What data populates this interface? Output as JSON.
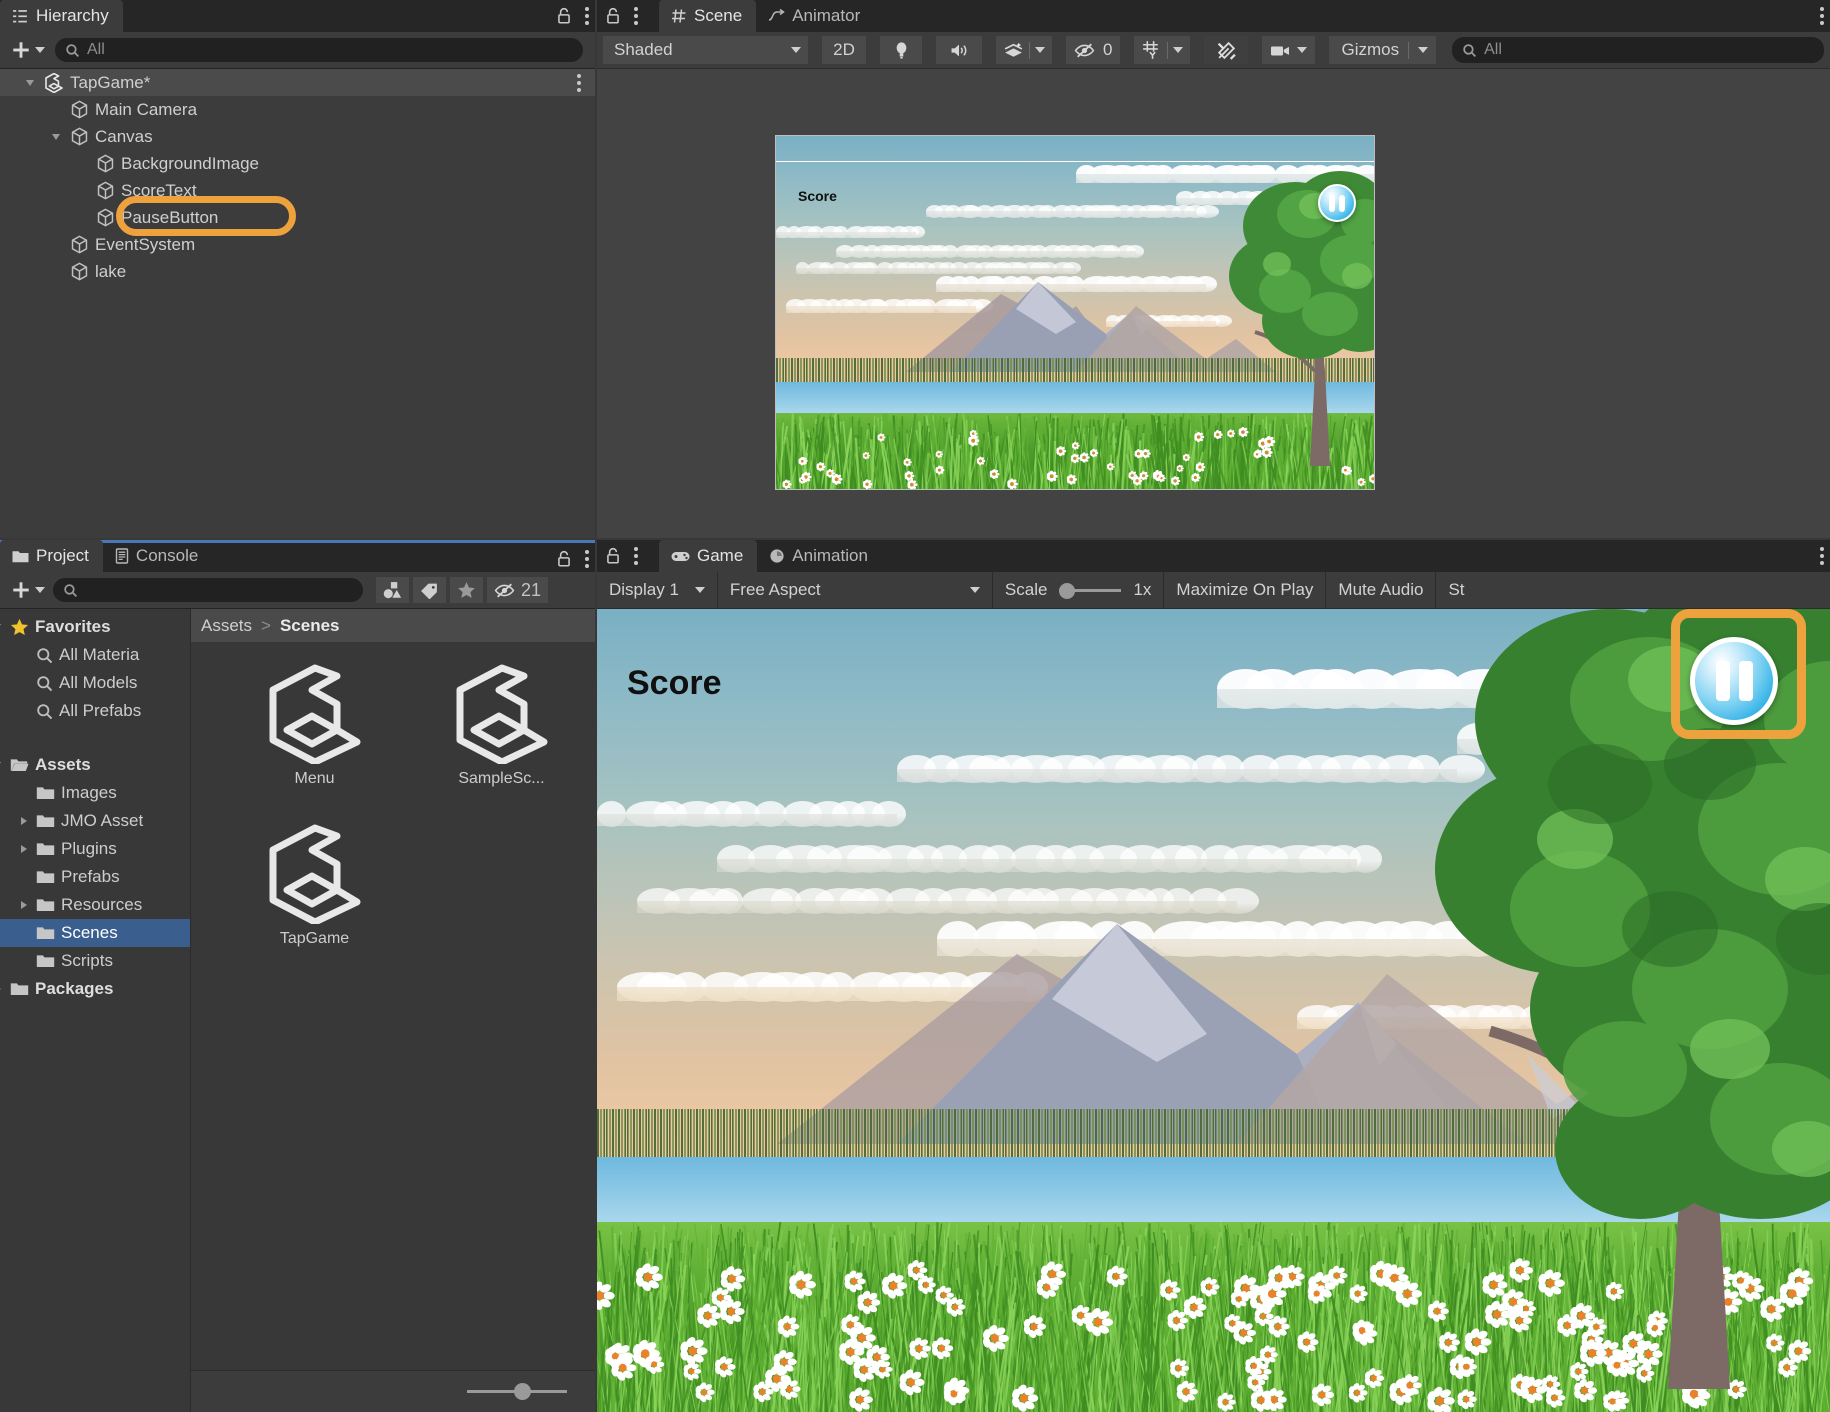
{
  "hierarchy": {
    "tab_label": "Hierarchy",
    "tab_icon": "hierarchy-icon",
    "search_placeholder": "All",
    "search_value": "",
    "items": [
      {
        "label": "TapGame*",
        "depth": 0,
        "icon": "unity-scene-icon",
        "expanded": true,
        "selected": true,
        "kebab": true
      },
      {
        "label": "Main Camera",
        "depth": 1,
        "icon": "gameobject-icon",
        "expanded": null
      },
      {
        "label": "Canvas",
        "depth": 1,
        "icon": "gameobject-icon",
        "expanded": true
      },
      {
        "label": "BackgroundImage",
        "depth": 2,
        "icon": "gameobject-icon",
        "expanded": null
      },
      {
        "label": "ScoreText",
        "depth": 2,
        "icon": "gameobject-icon",
        "expanded": null
      },
      {
        "label": "PauseButton",
        "depth": 2,
        "icon": "gameobject-icon",
        "expanded": null,
        "highlighted": true
      },
      {
        "label": "EventSystem",
        "depth": 1,
        "icon": "gameobject-icon",
        "expanded": null
      },
      {
        "label": "lake",
        "depth": 1,
        "icon": "gameobject-icon",
        "expanded": null
      }
    ]
  },
  "scene": {
    "tabs": [
      {
        "label": "Scene",
        "icon": "scene-grid-icon",
        "active": true
      },
      {
        "label": "Animator",
        "icon": "animator-icon",
        "active": false
      }
    ],
    "toolbar": {
      "shading_mode": "Shaded",
      "mode_2d": "2D",
      "lighting_icon": "lightbulb-icon",
      "audio_icon": "speaker-icon",
      "fx_icon": "effects-icon",
      "hidden_icon": "eye-off-icon",
      "hidden_count": "0",
      "grid_icon": "grid-y-icon",
      "tools_icon": "tools-icon",
      "camera_icon": "camera-icon",
      "gizmos_label": "Gizmos",
      "search_placeholder": "All",
      "search_value": ""
    },
    "viewport": {
      "score_label": "Score",
      "pause_icon": "pause-icon"
    }
  },
  "project": {
    "tabs": [
      {
        "label": "Project",
        "icon": "folder-icon",
        "active": true
      },
      {
        "label": "Console",
        "icon": "console-icon",
        "active": false
      }
    ],
    "toolbar": {
      "search_placeholder": "",
      "search_value": "",
      "filter_type_icon": "shapes-filter-icon",
      "filter_label_icon": "tag-icon",
      "favorite_icon": "star-icon",
      "hidden_icon": "eye-off-icon",
      "hidden_count": "21"
    },
    "tree": [
      {
        "label": "Favorites",
        "depth": 0,
        "icon": "star-icon",
        "expanded": true,
        "bold": true
      },
      {
        "label": "All Materia",
        "depth": 1,
        "icon": "search-icon"
      },
      {
        "label": "All Models",
        "depth": 1,
        "icon": "search-icon"
      },
      {
        "label": "All Prefabs",
        "depth": 1,
        "icon": "search-icon"
      },
      {
        "label": "",
        "depth": 0,
        "icon": "spacer",
        "spacer": true
      },
      {
        "label": "Assets",
        "depth": 0,
        "icon": "folder-open-icon",
        "expanded": true,
        "bold": true
      },
      {
        "label": "Images",
        "depth": 1,
        "icon": "folder-icon"
      },
      {
        "label": "JMO Asset",
        "depth": 1,
        "icon": "folder-icon",
        "expanded": false
      },
      {
        "label": "Plugins",
        "depth": 1,
        "icon": "folder-icon",
        "expanded": false
      },
      {
        "label": "Prefabs",
        "depth": 1,
        "icon": "folder-icon"
      },
      {
        "label": "Resources",
        "depth": 1,
        "icon": "folder-icon",
        "expanded": false
      },
      {
        "label": "Scenes",
        "depth": 1,
        "icon": "folder-icon",
        "selected": true
      },
      {
        "label": "Scripts",
        "depth": 1,
        "icon": "folder-icon"
      },
      {
        "label": "Packages",
        "depth": 0,
        "icon": "folder-icon",
        "expanded": false,
        "bold": true
      }
    ],
    "breadcrumb": {
      "root": "Assets",
      "separator": ">",
      "current": "Scenes"
    },
    "assets": [
      {
        "label": "Menu",
        "icon": "unity-scene-icon"
      },
      {
        "label": "SampleSc...",
        "icon": "unity-scene-icon"
      },
      {
        "label": "TapGame",
        "icon": "unity-scene-icon"
      }
    ],
    "zoom_slider_value": "47"
  },
  "game": {
    "tabs": [
      {
        "label": "Game",
        "icon": "gamepad-icon",
        "active": true
      },
      {
        "label": "Animation",
        "icon": "clock-icon",
        "active": false
      }
    ],
    "toolbar": {
      "display": "Display 1",
      "aspect": "Free Aspect",
      "scale_label": "Scale",
      "scale_value": "1x",
      "maximize_on_play": "Maximize On Play",
      "mute_audio": "Mute Audio",
      "stats": "St"
    },
    "viewport": {
      "score_label": "Score",
      "pause_icon": "pause-icon"
    }
  },
  "colors": {
    "highlight": "#eda23d",
    "selection": "#3a5f8f",
    "panel_bg": "#3c3c3c",
    "tabbar_bg": "#262626",
    "accent_tab_underline": "#4a78b4"
  }
}
